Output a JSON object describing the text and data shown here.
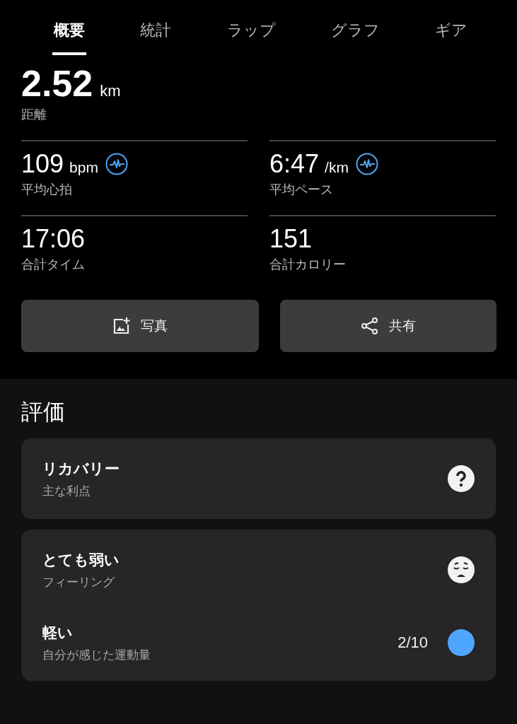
{
  "tabs": [
    {
      "label": "概要",
      "selected": true
    },
    {
      "label": "統計",
      "selected": false
    },
    {
      "label": "ラップ",
      "selected": false
    },
    {
      "label": "グラフ",
      "selected": false
    },
    {
      "label": "ギア",
      "selected": false
    }
  ],
  "distance": {
    "value": "2.52",
    "unit": "km",
    "label": "距離"
  },
  "stats": [
    {
      "value": "109",
      "unit": "bpm",
      "label": "平均心拍",
      "chart_link": true
    },
    {
      "value": "6:47",
      "unit": "/km",
      "label": "平均ペース",
      "chart_link": true
    },
    {
      "value": "17:06",
      "label": "合計タイム"
    },
    {
      "value": "151",
      "label": "合計カロリー"
    }
  ],
  "buttons": [
    {
      "kind": "photo",
      "label": "写真"
    },
    {
      "kind": "share",
      "label": "共有"
    }
  ],
  "evaluation": {
    "title": "評価",
    "cards": [
      {
        "rows": [
          {
            "kind": "question",
            "title": "リカバリー",
            "subtitle": "主な利点"
          }
        ]
      },
      {
        "rows": [
          {
            "kind": "face",
            "title": "とても弱い",
            "subtitle": "フィーリング"
          },
          {
            "kind": "dot",
            "title": "軽い",
            "subtitle": "自分が感じた運動量",
            "reading": "2/10",
            "color": "#4fa6ff"
          }
        ]
      }
    ]
  }
}
